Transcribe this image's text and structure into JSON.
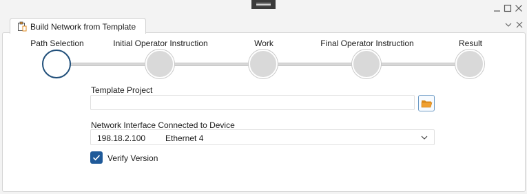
{
  "window": {
    "maximize_icon": "□",
    "close_icon": "✕"
  },
  "tab": {
    "title": "Build Network from Template",
    "icon": "clipboard-icon"
  },
  "tab_controls": {
    "collapse_icon": "∨",
    "close_icon": "✕"
  },
  "wizard": {
    "steps": [
      {
        "label": "Path Selection",
        "active": true
      },
      {
        "label": "Initial Operator Instruction",
        "active": false
      },
      {
        "label": "Work",
        "active": false
      },
      {
        "label": "Final Operator Instruction",
        "active": false
      },
      {
        "label": "Result",
        "active": false
      }
    ]
  },
  "form": {
    "template_project_label": "Template Project",
    "template_project_value": "",
    "network_interface_label": "Network Interface Connected to Device",
    "network_interface_ip": "198.18.2.100",
    "network_interface_name": "Ethernet 4",
    "verify_version_label": "Verify Version",
    "verify_version_checked": true
  },
  "colors": {
    "accent": "#1f5a99",
    "step_active_border": "#1f4e79",
    "folder": "#f0a030"
  }
}
